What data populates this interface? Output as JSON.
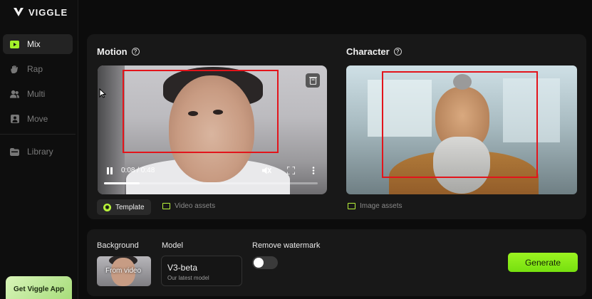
{
  "app": {
    "brand": "VIGGLE",
    "accent": "#a3f02a"
  },
  "sidebar": {
    "items": [
      {
        "label": "Mix",
        "icon": "play-square-icon",
        "active": true
      },
      {
        "label": "Rap",
        "icon": "hand-icon",
        "active": false
      },
      {
        "label": "Multi",
        "icon": "users-icon",
        "active": false
      },
      {
        "label": "Move",
        "icon": "person-square-icon",
        "active": false
      },
      {
        "label": "Library",
        "icon": "folder-icon",
        "active": false
      }
    ],
    "get_app": "Get Viggle App"
  },
  "motion": {
    "title": "Motion",
    "video": {
      "time": "0:08 / 0:48",
      "progress": 0.167
    },
    "tabs": {
      "template": "Template",
      "assets": "Video assets"
    }
  },
  "character": {
    "title": "Character",
    "assets": "Image assets"
  },
  "settings": {
    "background_label": "Background",
    "background_value": "From video",
    "model_label": "Model",
    "model_name": "V3-beta",
    "model_desc": "Our latest model",
    "watermark_label": "Remove watermark",
    "watermark_on": false
  },
  "generate_label": "Generate",
  "annotation_color": "#e3141b"
}
